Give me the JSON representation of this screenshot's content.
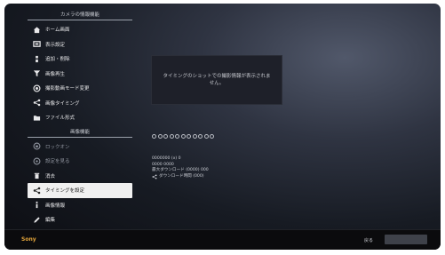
{
  "menu": {
    "header": "カメラの情報機能",
    "items": [
      {
        "label": "ホーム画面",
        "icon": "home-icon"
      },
      {
        "label": "表示設定",
        "icon": "display-icon"
      },
      {
        "label": "追加・削除",
        "icon": "add-icon"
      },
      {
        "label": "画像再生",
        "icon": "filter-icon"
      },
      {
        "label": "撮影動画モード変更",
        "icon": "record-icon"
      },
      {
        "label": "画像タイミング",
        "icon": "share-icon"
      },
      {
        "label": "ファイル形式",
        "icon": "folder-icon"
      }
    ],
    "section_header": "画像機能",
    "section_items": [
      {
        "label": "ロックオン",
        "icon": "lock-icon",
        "dim": true
      },
      {
        "label": "設定を見る",
        "icon": "settings-icon",
        "dim": true
      },
      {
        "label": "消去",
        "icon": "trash-icon",
        "dim": false
      },
      {
        "label": "タイミングを設定",
        "icon": "share-icon",
        "selected": true
      },
      {
        "label": "画像情報",
        "icon": "info-icon"
      },
      {
        "label": "編集",
        "icon": "edit-icon"
      }
    ]
  },
  "preview": {
    "message": "タイミングのショットでの撮影情報が表示されません。"
  },
  "details": {
    "circles_count": 11,
    "lines": [
      "0000000 (x)  0",
      "0000  0000",
      "最大ダウンロード (0000) 000",
      "ダウンロード時間 (000)"
    ]
  },
  "bottom": {
    "brand": "Sony",
    "back_label": "戻る"
  },
  "colors": {
    "accent": "#e0a33a",
    "selected_bg": "#f0f0f0"
  }
}
